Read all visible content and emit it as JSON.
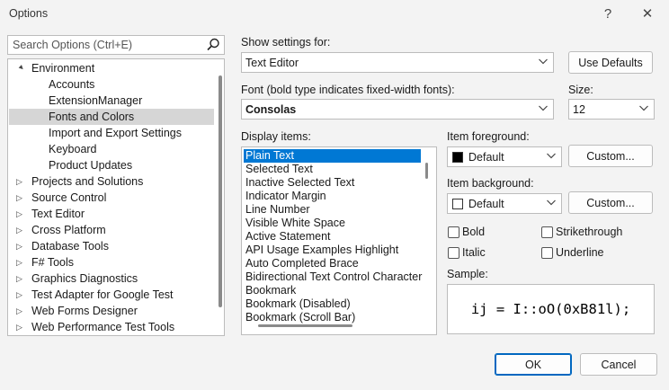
{
  "window": {
    "title": "Options",
    "help_glyph": "?",
    "close_glyph": "✕"
  },
  "search": {
    "placeholder": "Search Options (Ctrl+E)"
  },
  "tree": {
    "items": [
      {
        "label": "Environment",
        "level": 0,
        "expander": "▲",
        "selected": false
      },
      {
        "label": "Accounts",
        "level": 1,
        "expander": "",
        "selected": false
      },
      {
        "label": "ExtensionManager",
        "level": 1,
        "expander": "",
        "selected": false
      },
      {
        "label": "Fonts and Colors",
        "level": 1,
        "expander": "",
        "selected": true
      },
      {
        "label": "Import and Export Settings",
        "level": 1,
        "expander": "",
        "selected": false
      },
      {
        "label": "Keyboard",
        "level": 1,
        "expander": "",
        "selected": false
      },
      {
        "label": "Product Updates",
        "level": 1,
        "expander": "",
        "selected": false
      },
      {
        "label": "Projects and Solutions",
        "level": 0,
        "expander": "▷",
        "selected": false
      },
      {
        "label": "Source Control",
        "level": 0,
        "expander": "▷",
        "selected": false
      },
      {
        "label": "Text Editor",
        "level": 0,
        "expander": "▷",
        "selected": false
      },
      {
        "label": "Cross Platform",
        "level": 0,
        "expander": "▷",
        "selected": false
      },
      {
        "label": "Database Tools",
        "level": 0,
        "expander": "▷",
        "selected": false
      },
      {
        "label": "F# Tools",
        "level": 0,
        "expander": "▷",
        "selected": false
      },
      {
        "label": "Graphics Diagnostics",
        "level": 0,
        "expander": "▷",
        "selected": false
      },
      {
        "label": "Test Adapter for Google Test",
        "level": 0,
        "expander": "▷",
        "selected": false
      },
      {
        "label": "Web Forms Designer",
        "level": 0,
        "expander": "▷",
        "selected": false
      },
      {
        "label": "Web Performance Test Tools",
        "level": 0,
        "expander": "▷",
        "selected": false
      }
    ]
  },
  "show_settings": {
    "label": "Show settings for:",
    "value": "Text Editor"
  },
  "use_defaults_label": "Use Defaults",
  "font": {
    "label": "Font (bold type indicates fixed-width fonts):",
    "value": "Consolas"
  },
  "size": {
    "label": "Size:",
    "value": "12"
  },
  "display_items": {
    "label": "Display items:",
    "items": [
      "Plain Text",
      "Selected Text",
      "Inactive Selected Text",
      "Indicator Margin",
      "Line Number",
      "Visible White Space",
      "Active Statement",
      "API Usage Examples Highlight",
      "Auto Completed Brace",
      "Bidirectional Text Control Character",
      "Bookmark",
      "Bookmark (Disabled)",
      "Bookmark (Scroll Bar)"
    ],
    "selected_index": 0
  },
  "item_foreground": {
    "label": "Item foreground:",
    "value": "Default",
    "swatch_color": "#000000",
    "custom_label": "Custom..."
  },
  "item_background": {
    "label": "Item background:",
    "value": "Default",
    "swatch_color": "#ffffff",
    "custom_label": "Custom..."
  },
  "styles": {
    "bold": "Bold",
    "italic": "Italic",
    "strikethrough": "Strikethrough",
    "underline": "Underline"
  },
  "sample": {
    "label": "Sample:",
    "text": "ij = I::oO(0xB81l);"
  },
  "buttons": {
    "ok": "OK",
    "cancel": "Cancel"
  },
  "colors": {
    "accent": "#0067c0",
    "selection": "#0078d4",
    "tree_selection": "#d6d6d6"
  }
}
